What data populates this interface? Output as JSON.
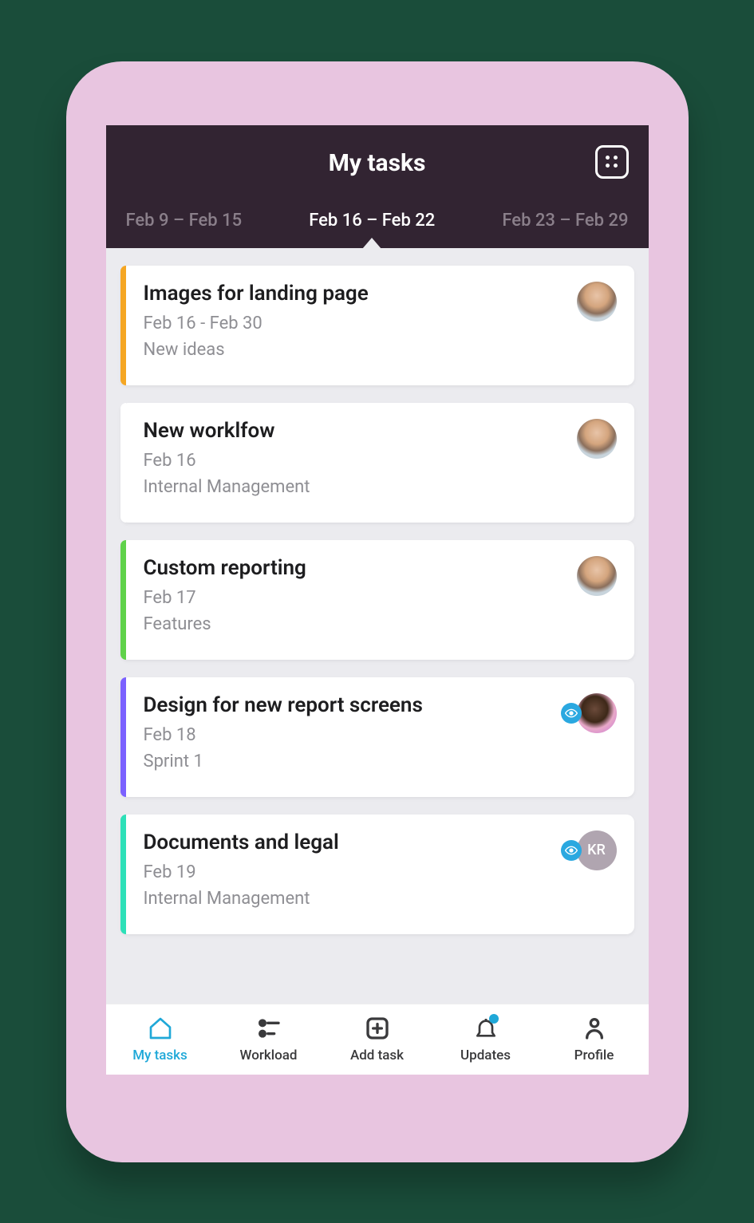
{
  "header": {
    "title": "My tasks"
  },
  "dateTabs": [
    {
      "label": "Feb 9 – Feb 15",
      "active": false
    },
    {
      "label": "Feb 16 – Feb 22",
      "active": true
    },
    {
      "label": "Feb 23 – Feb 29",
      "active": false
    }
  ],
  "tasks": [
    {
      "title": "Images for landing page",
      "date": "Feb 16 - Feb 30",
      "category": "New ideas",
      "stripe": "#f5a623",
      "avatarType": "photo1",
      "watching": false
    },
    {
      "title": "New worklfow",
      "date": "Feb 16",
      "category": "Internal Management",
      "stripe": "#ffffff",
      "avatarType": "photo1",
      "watching": false
    },
    {
      "title": "Custom reporting",
      "date": "Feb 17",
      "category": "Features",
      "stripe": "#5fd24a",
      "avatarType": "photo1",
      "watching": false
    },
    {
      "title": "Design for new report screens",
      "date": "Feb 18",
      "category": "Sprint 1",
      "stripe": "#7b61ff",
      "avatarType": "photo2",
      "watching": true
    },
    {
      "title": "Documents and legal",
      "date": "Feb 19",
      "category": "Internal Management",
      "stripe": "#2de0b8",
      "avatarType": "initials",
      "initials": "KR",
      "watching": true
    }
  ],
  "nav": [
    {
      "label": "My tasks",
      "icon": "home",
      "active": true
    },
    {
      "label": "Workload",
      "icon": "sliders",
      "active": false
    },
    {
      "label": "Add task",
      "icon": "plus-square",
      "active": false
    },
    {
      "label": "Updates",
      "icon": "bell",
      "active": false,
      "badge": true
    },
    {
      "label": "Profile",
      "icon": "user",
      "active": false
    }
  ]
}
